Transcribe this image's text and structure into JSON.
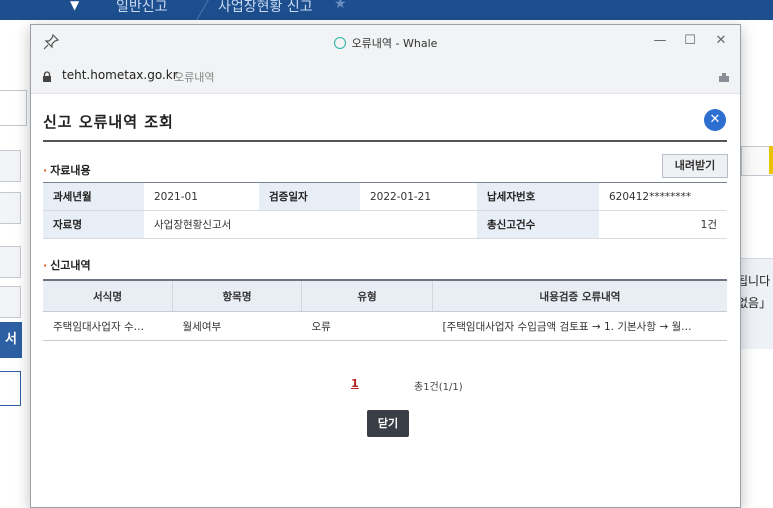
{
  "background": {
    "nav_items": [
      "일반신고",
      "사업장현황 신고"
    ],
    "side_button_label": "서",
    "right_text_lines": [
      "됩니다",
      "없음」 "
    ]
  },
  "window": {
    "title": "오류내역 - Whale",
    "url_host": "teht.hometax.go.kr",
    "url_title": "오류내역"
  },
  "popup": {
    "title": "신고 오류내역 조회",
    "section1_title": "자료내용",
    "download_label": "내려받기",
    "info": {
      "tax_period_label": "과세년월",
      "tax_period_value": "2021-01",
      "verify_date_label": "검증일자",
      "verify_date_value": "2022-01-21",
      "taxpayer_no_label": "납세자번호",
      "taxpayer_no_value": "620412********",
      "data_name_label": "자료명",
      "data_name_value": "사업장현황신고서",
      "total_count_label": "총신고건수",
      "total_count_value": "1건"
    },
    "section2_title": "신고내역",
    "list_headers": [
      "서식명",
      "항목명",
      "유형",
      "내용검증 오류내역"
    ],
    "list_rows": [
      [
        "주택임대사업자 수…",
        "월세여부",
        "오류",
        "[주택임대사업자 수입금액 검토표 → 1. 기본사항 → 월…"
      ]
    ],
    "page_current": "1",
    "page_total": "총1건(1/1)",
    "close_label": "닫기"
  },
  "colors": {
    "nav_bg": "#1d4f8f",
    "accent_blue": "#2d6fd0",
    "header_cell_bg": "#e8eef6",
    "close_button_bg": "#3a3f47"
  }
}
